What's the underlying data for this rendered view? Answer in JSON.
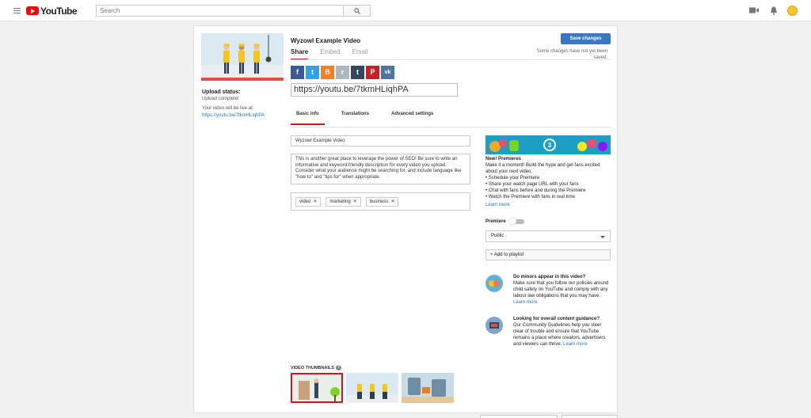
{
  "header": {
    "logo_text": "YouTube",
    "search_placeholder": "Search"
  },
  "video": {
    "title": "Wyzowl Example Video",
    "save_label": "Save changes",
    "save_note": "Some changes have not yet been saved."
  },
  "share_tabs": [
    "Share",
    "Embed",
    "Email"
  ],
  "share_url": "https://youtu.be/7tkmHLiqhPA",
  "social": [
    {
      "name": "facebook",
      "glyph": "f",
      "color": "#3b5998"
    },
    {
      "name": "twitter",
      "glyph": "t",
      "color": "#2da3e0"
    },
    {
      "name": "blogger",
      "glyph": "B",
      "color": "#f47f20"
    },
    {
      "name": "reddit",
      "glyph": "r",
      "color": "#aeb6be"
    },
    {
      "name": "tumblr",
      "glyph": "t",
      "color": "#36465d"
    },
    {
      "name": "pinterest",
      "glyph": "P",
      "color": "#cb2027"
    },
    {
      "name": "vk",
      "glyph": "vk",
      "color": "#4c75a3"
    }
  ],
  "upload": {
    "status_label": "Upload status:",
    "status_value": "Upload complete!",
    "live_text": "Your video will be live at:",
    "live_link": "https://youtu.be/7tkmHLiqhPA"
  },
  "info_tabs": [
    "Basic info",
    "Translations",
    "Advanced settings"
  ],
  "form": {
    "title_value": "Wyzowl Example Video",
    "description": "This is another great place to leverage the power of SEO! Be sure to write an informative and keyword-friendly description for every video you upload. Consider what your audience might be searching for, and include language like \"how to\" and \"tips for\" when appropriate.",
    "tags": [
      "video",
      "marketing",
      "business"
    ]
  },
  "premieres": {
    "badge": "3",
    "heading": "New! Premieres",
    "intro": "Make it a moment! Build the hype and get fans excited about your next video.",
    "bullets": [
      "• Schedule your Premiere",
      "• Share your watch page URL with your fans",
      "• Chat with fans before and during the Premiere",
      "• Watch the Premiere with fans in real time"
    ],
    "learn_more": "Learn more",
    "toggle_label": "Premiere",
    "privacy": "Public",
    "add_playlist": "+ Add to playlist"
  },
  "guidance": [
    {
      "heading": "Do minors appear in this video?",
      "body": "Make sure that you follow our policies around child safety on YouTube and comply with any labour law obligations that you may have.",
      "link": "Learn more"
    },
    {
      "heading": "Looking for overall content guidance?",
      "body": "Our Community Guidelines help you steer clear of trouble and ensure that YouTube remains a place where creators, advertisers and viewers can thrive.",
      "link": "Learn more"
    }
  ],
  "thumbnails_label": "VIDEO THUMBNAILS",
  "colors": {
    "accent_red": "#cc181e",
    "link_blue": "#167ac6",
    "save_blue": "#3878c7"
  }
}
